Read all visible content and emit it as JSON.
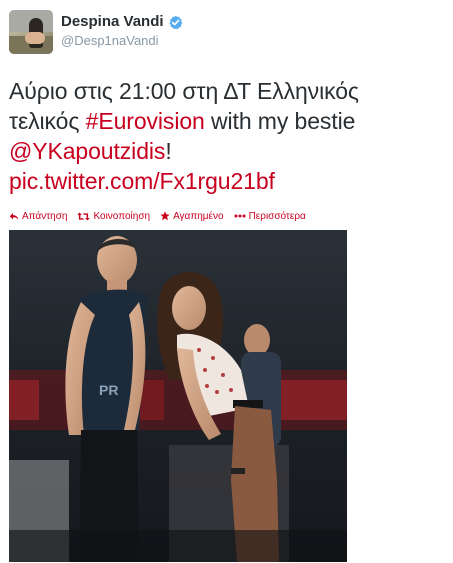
{
  "user": {
    "display_name": "Despina Vandi",
    "handle": "@Desp1naVandi",
    "verified": true
  },
  "tweet": {
    "text_line1": "Αύριο στις 21:00 στη ΔΤ Ελληνικός",
    "text_line2_plain": "τελικός ",
    "hashtag": "#Eurovision",
    "text_line2_tail": " with my bestie",
    "mention": "@YKapoutzidis",
    "mention_tail": "!",
    "pic_link": "pic.twitter.com/Fx1rgu21bf"
  },
  "actions": [
    {
      "label": "Απάντηση",
      "icon": "reply-icon"
    },
    {
      "label": "Κοινοποίηση",
      "icon": "retweet-icon"
    },
    {
      "label": "Αγαπημένο",
      "icon": "favorite-star-icon"
    },
    {
      "label": "Περισσότερα",
      "icon": "more-dots-icon"
    }
  ],
  "colors": {
    "accent": "#c8001e",
    "text": "#292f33",
    "muted": "#8899a6",
    "verified": "#55acee"
  }
}
